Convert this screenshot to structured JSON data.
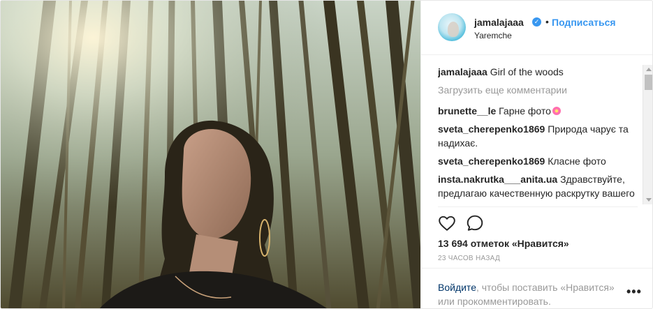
{
  "post": {
    "username": "jamalajaaa",
    "follow_label": "Подписаться",
    "separator": "•",
    "location": "Yaremche",
    "verified_mark": "✓"
  },
  "comments": {
    "caption": {
      "user": "jamalajaaa",
      "text": "Girl of the woods"
    },
    "load_more": "Загрузить еще комментарии",
    "items": [
      {
        "user": "brunette__le",
        "text": "Гарне фото"
      },
      {
        "user": "sveta_cherepenko1869",
        "text": "Природа чарує та надихає."
      },
      {
        "user": "sveta_cherepenko1869",
        "text": "Класне фото"
      },
      {
        "user": "insta.nakrutka___anita.ua",
        "text": "Здравствуйте, предлагаю качественную раскрутку вашего аккаунта. Также предлагаю"
      }
    ]
  },
  "stats": {
    "likes": "13 694 отметок «Нравится»",
    "time": "23 часов назад"
  },
  "footer": {
    "login_link": "Войдите",
    "login_rest": ", чтобы поставить «Нравится» или прокомментировать.",
    "more_label": "•••"
  },
  "icons": {
    "heart": "heart-icon",
    "comment": "comment-icon",
    "verified": "verified-badge-icon",
    "more": "more-options-icon"
  },
  "colors": {
    "link_blue": "#3897f0",
    "muted": "#999999",
    "text": "#262626",
    "login_link": "#003569"
  }
}
